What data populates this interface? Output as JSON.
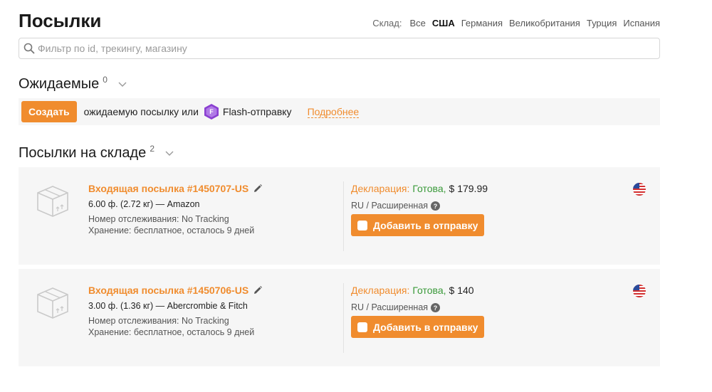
{
  "page": {
    "title": "Посылки"
  },
  "warehouse": {
    "label": "Склад:",
    "options": [
      "Все",
      "США",
      "Германия",
      "Великобритания",
      "Турция",
      "Испания"
    ],
    "selected": "США"
  },
  "search": {
    "placeholder": "Фильтр по id, трекингу, магазину",
    "value": ""
  },
  "expected": {
    "heading": "Ожидаемые",
    "count": "0",
    "create_label": "Создать",
    "text": "ожидаемую посылку или",
    "flash_text": "Flash-отправку",
    "more_link": "Подробнее"
  },
  "stock": {
    "heading": "Посылки на складе",
    "count": "2",
    "parcels": [
      {
        "title": "Входящая посылка #1450707-US",
        "weight": "6.00 ф. (2.72 кг)",
        "store": "— Amazon",
        "tracking": "Номер отслеживания: No Tracking",
        "storage": "Хранение: бесплатное, осталось 9 дней",
        "decl_label": "Декларация:",
        "decl_status": "Готова,",
        "decl_price": "$ 179.99",
        "lang": "RU / Расширенная",
        "add_label": "Добавить в отправку"
      },
      {
        "title": "Входящая посылка #1450706-US",
        "weight": "3.00 ф. (1.36 кг)",
        "store": "— Abercrombie & Fitch",
        "tracking": "Номер отслеживания: No Tracking",
        "storage": "Хранение: бесплатное, осталось 9 дней",
        "decl_label": "Декларация:",
        "decl_status": "Готова,",
        "decl_price": "$ 140",
        "lang": "RU / Расширенная",
        "add_label": "Добавить в отправку"
      }
    ]
  },
  "icons": {
    "search": "search-icon",
    "chevron": "chevron-down-icon",
    "box": "box-icon",
    "edit": "pencil-icon",
    "help": "question-icon",
    "flag": "us-flag-icon",
    "flash": "flash-logo-icon"
  },
  "colors": {
    "accent": "#f08c2e",
    "success": "#3a9a3a",
    "card_bg": "#f6f6f6"
  }
}
